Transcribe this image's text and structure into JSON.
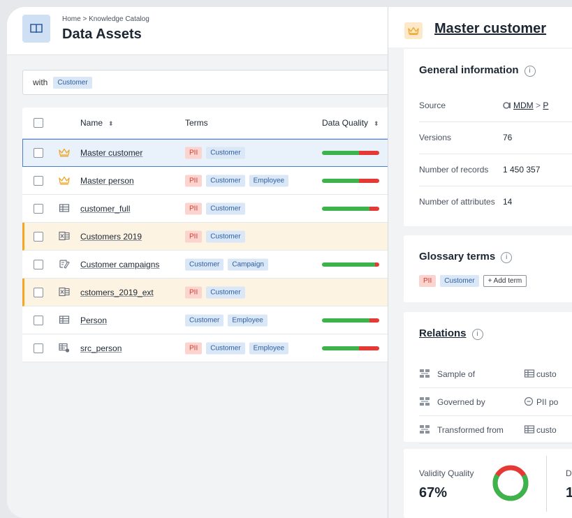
{
  "header": {
    "breadcrumb": "Home > Knowledge Catalog",
    "title": "Data Assets"
  },
  "filter": {
    "prefix": "with",
    "chip": "Customer"
  },
  "table": {
    "columns": {
      "name": "Name",
      "terms": "Terms",
      "quality": "Data Quality"
    },
    "rows": [
      {
        "icon": "crown-icon",
        "name": "Master customer",
        "terms": [
          "PII",
          "Customer"
        ],
        "quality_green": 0.65,
        "quality_red": 0.35
      },
      {
        "icon": "crown-icon",
        "name": "Master person",
        "terms": [
          "PII",
          "Customer",
          "Employee"
        ],
        "quality_green": 0.65,
        "quality_red": 0.35
      },
      {
        "icon": "table-icon",
        "name": "customer_full",
        "terms": [
          "PII",
          "Customer"
        ],
        "quality_green": 0.83,
        "quality_red": 0.17
      },
      {
        "icon": "excel-icon",
        "name": "Customers 2019",
        "terms": [
          "PII",
          "Customer"
        ],
        "quality_green": null,
        "quality_red": null
      },
      {
        "icon": "report-icon",
        "name": "Customer campaigns",
        "terms": [
          "Customer",
          "Campaign"
        ],
        "quality_green": 0.93,
        "quality_red": 0.07
      },
      {
        "icon": "excel-icon",
        "name": "cstomers_2019_ext",
        "terms": [
          "PII",
          "Customer"
        ],
        "quality_green": null,
        "quality_red": null
      },
      {
        "icon": "table-icon",
        "name": "Person",
        "terms": [
          "Customer",
          "Employee"
        ],
        "quality_green": 0.83,
        "quality_red": 0.17
      },
      {
        "icon": "table-gear-icon",
        "name": "src_person",
        "terms": [
          "PII",
          "Customer",
          "Employee"
        ],
        "quality_green": 0.65,
        "quality_red": 0.35
      }
    ]
  },
  "detail": {
    "title": "Master customer",
    "general": {
      "title": "General information",
      "source_label": "Source",
      "source_value": "MDM",
      "source_sep": ">",
      "source_rest": "P",
      "versions_label": "Versions",
      "versions_value": "76",
      "records_label": "Number of records",
      "records_value": "1 450 357",
      "attributes_label": "Number of attributes",
      "attributes_value": "14"
    },
    "glossary": {
      "title": "Glossary terms",
      "terms": [
        "PII",
        "Customer"
      ],
      "add_label": "+ Add term"
    },
    "relations": {
      "title": "Relations",
      "items": [
        {
          "label": "Sample of",
          "target": "custo"
        },
        {
          "label": "Governed by",
          "target": "PII po"
        },
        {
          "label": "Transformed from",
          "target": "custo"
        }
      ]
    },
    "quality": {
      "label": "Validity Quality",
      "value": "67%",
      "fraction": 0.67,
      "next_label": "D",
      "next_value": "1"
    }
  },
  "colors": {
    "green": "#3cb44b",
    "red": "#e53935",
    "accent": "#4a7fd0",
    "warn": "#f5a623"
  }
}
